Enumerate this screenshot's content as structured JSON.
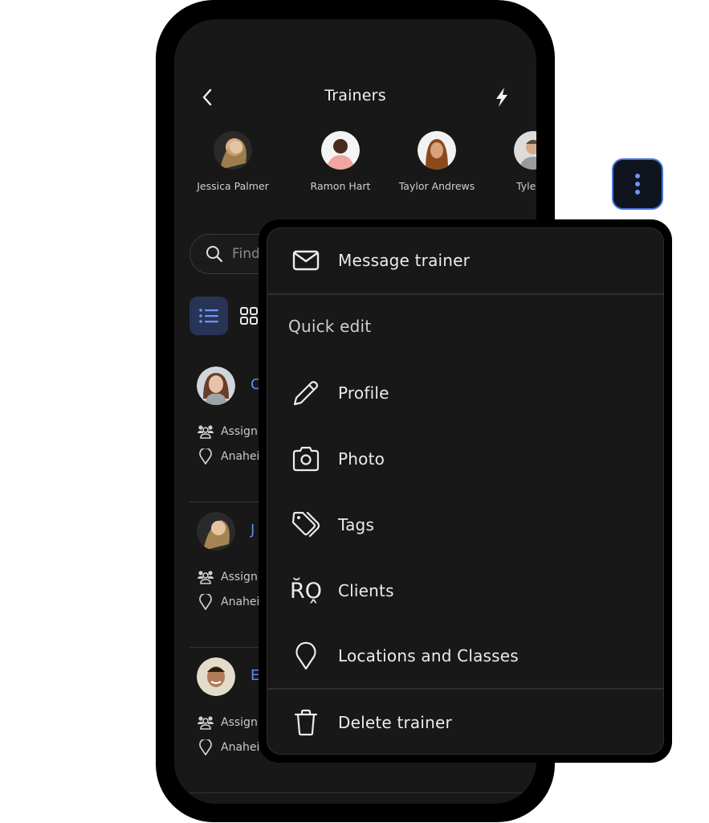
{
  "header": {
    "title": "Trainers",
    "back_icon": "chevron-left-icon",
    "action_icon": "lightning-bolt-icon"
  },
  "featured_trainers": [
    {
      "name": "Jessica Palmer",
      "avatar_color": "#c9a27a"
    },
    {
      "name": "Ramon Hart",
      "avatar_color": "#e8a4a0"
    },
    {
      "name": "Taylor Andrews",
      "avatar_color": "#b86a2e"
    },
    {
      "name": "Tyler B",
      "avatar_color": "#bfbfbf"
    }
  ],
  "search": {
    "placeholder": "Find",
    "value": "",
    "icon": "search-icon"
  },
  "view_toggle": {
    "active": "list",
    "options": [
      {
        "id": "list",
        "icon": "list-icon"
      },
      {
        "id": "grid",
        "icon": "grid-icon"
      }
    ]
  },
  "trainer_list": [
    {
      "name": "C",
      "assigned": "Assign",
      "location": "Anahei",
      "avatar_color": "#b5a79a"
    },
    {
      "name": "J",
      "assigned": "Assign",
      "location": "Anahei",
      "avatar_color": "#c9a27a"
    },
    {
      "name": "E",
      "assigned": "Assign",
      "location": "Anahei",
      "avatar_color": "#d9cdb8"
    }
  ],
  "more_button": {
    "icon": "more-vertical-icon"
  },
  "menu": {
    "message": {
      "label": "Message trainer",
      "icon": "envelope-icon"
    },
    "section_label": "Quick edit",
    "quick_edit_items": [
      {
        "label": "Profile",
        "icon": "pencil-icon"
      },
      {
        "label": "Photo",
        "icon": "camera-icon"
      },
      {
        "label": "Tags",
        "icon": "tags-icon"
      },
      {
        "label": "Clients",
        "icon": "clients-icon",
        "glyph_text": "R̆O̭"
      },
      {
        "label": "Locations and Classes",
        "icon": "location-pin-icon"
      }
    ],
    "delete": {
      "label": "Delete trainer",
      "icon": "trash-icon"
    }
  },
  "colors": {
    "accent": "#5b8cf0",
    "screen_bg": "#181818",
    "active_toggle_bg": "#283456",
    "more_btn_border": "#4a78e0"
  }
}
